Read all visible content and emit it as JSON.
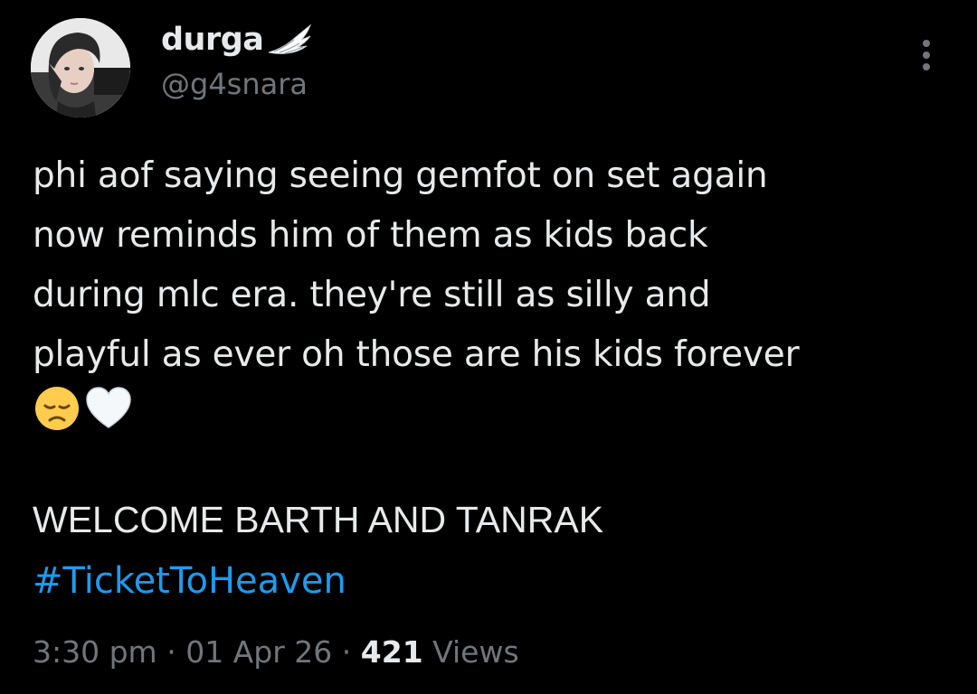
{
  "author": {
    "display_name": "durga",
    "badge_icon": "wing-icon",
    "handle": "@g4snara",
    "avatar_icon": "user-avatar"
  },
  "menu": {
    "more_icon": "more-vertical-icon"
  },
  "tweet": {
    "lines": [
      "phi aof saying seeing gemfot on set again",
      "now reminds him of them as kids back",
      "during mlc era. they're still as silly and",
      "playful as ever oh those are his kids forever"
    ],
    "emojis": [
      "😞",
      "🤍"
    ],
    "welcome": "WELCOME BARTH AND TANRAK",
    "hashtag": "#TicketToHeaven"
  },
  "meta": {
    "time": "3:30 pm",
    "separator": "·",
    "date": "01 Apr 26",
    "views_count": "421",
    "views_label": "Views"
  },
  "colors": {
    "background": "#000000",
    "text": "#e7e9ea",
    "muted": "#71767b",
    "link": "#1d9bf0"
  }
}
